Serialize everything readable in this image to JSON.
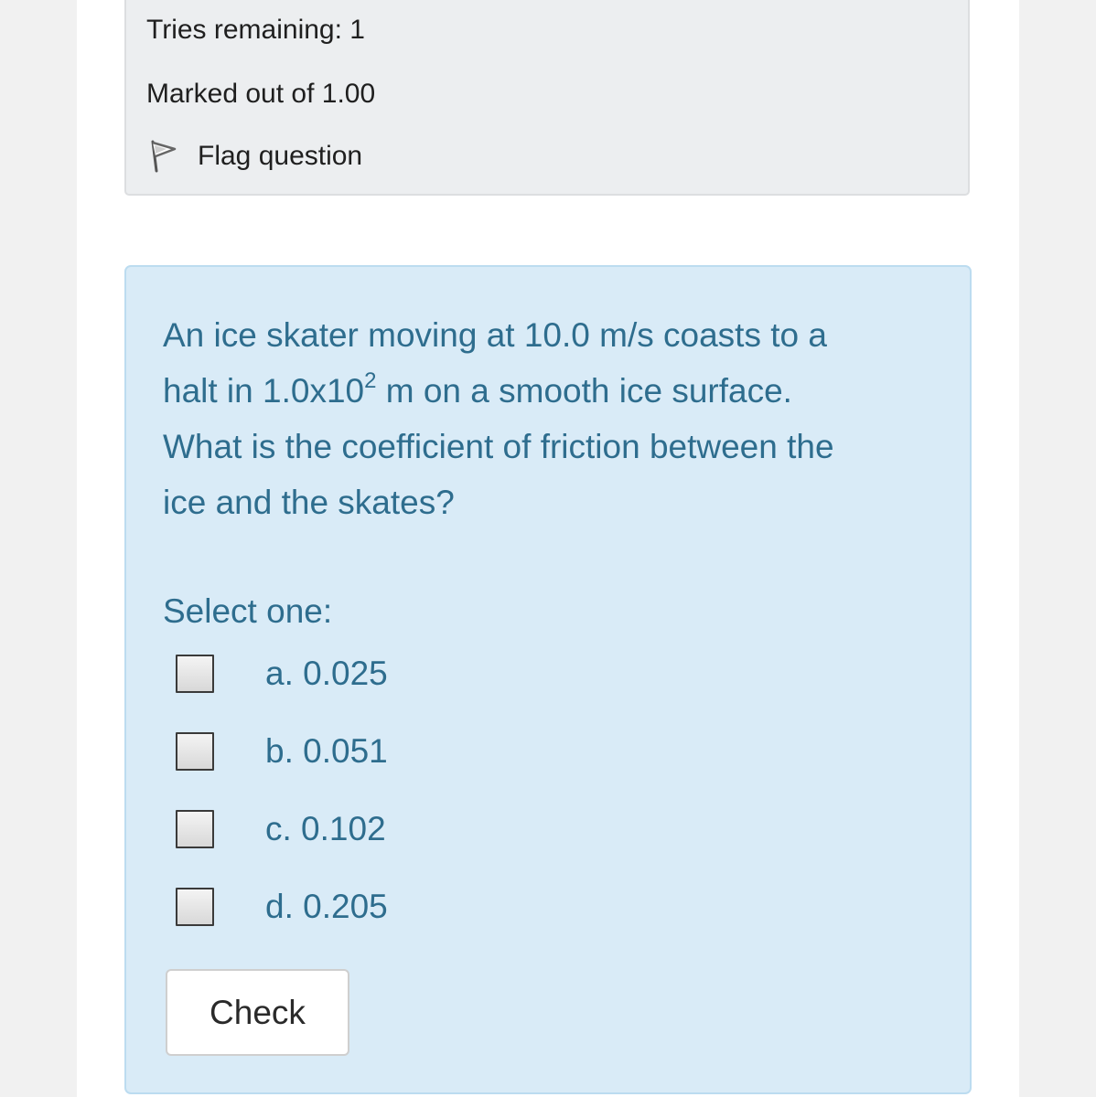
{
  "info": {
    "tries_remaining": "Tries remaining: 1",
    "marked_out_of": "Marked out of 1.00",
    "flag_label": "Flag question",
    "flag_icon": "flag-icon"
  },
  "question": {
    "text_line1": "An ice skater moving at 10.0 m/s coasts to a",
    "text_line2_before_exp": "halt in 1.0x10",
    "text_line2_exponent": "2",
    "text_line2_after_exp": " m on a smooth ice surface.",
    "text_line3": "What is the coefficient of friction between the",
    "text_line4": "ice and the skates?",
    "prompt": "Select one:",
    "options": [
      {
        "label": "a. 0.025",
        "checked": false
      },
      {
        "label": "b. 0.051",
        "checked": false
      },
      {
        "label": "c. 0.102",
        "checked": false
      },
      {
        "label": "d. 0.205",
        "checked": false
      }
    ],
    "check_button": "Check"
  },
  "colors": {
    "question_bg": "#d9ebf7",
    "question_text": "#2e6d8e",
    "info_bg": "#eceef0"
  }
}
